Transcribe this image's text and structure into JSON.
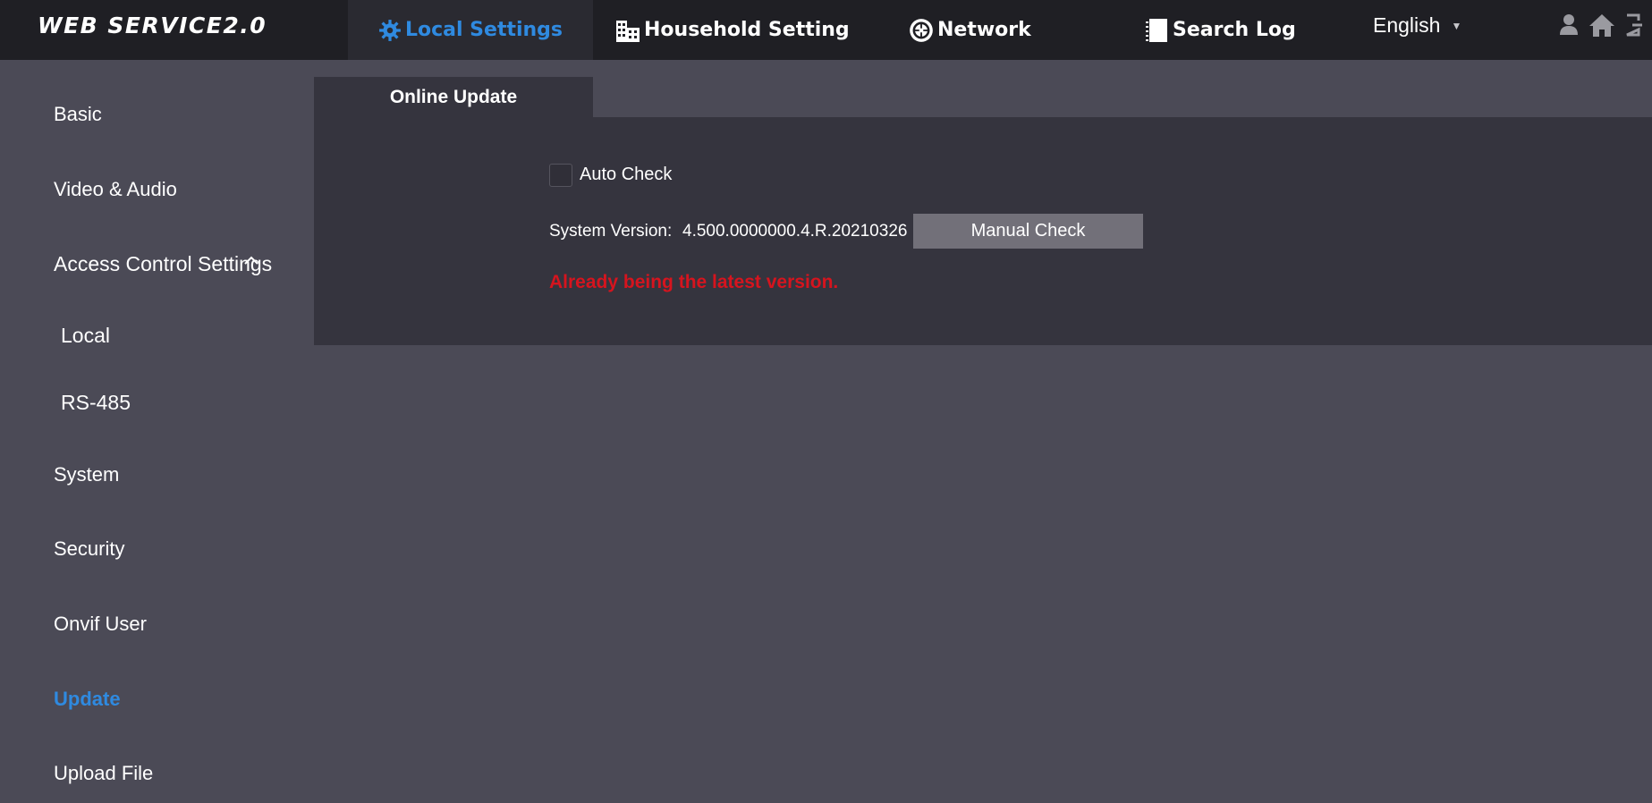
{
  "header": {
    "logo": "WEB SERVICE2.0",
    "nav": [
      {
        "label": "Local Settings",
        "icon": "gear-icon",
        "active": true
      },
      {
        "label": "Household Setting",
        "icon": "building-icon",
        "active": false
      },
      {
        "label": "Network",
        "icon": "globe-icon",
        "active": false
      },
      {
        "label": "Search Log",
        "icon": "log-icon",
        "active": false
      }
    ],
    "language": "English",
    "icons": [
      "user-icon",
      "home-icon",
      "logout-icon"
    ]
  },
  "sidebar": {
    "items": [
      {
        "label": "Basic"
      },
      {
        "label": "Video & Audio"
      },
      {
        "label": "Access Control Settings",
        "expanded": true
      },
      {
        "label": "Local"
      },
      {
        "label": "RS-485"
      },
      {
        "label": "System"
      },
      {
        "label": "Security"
      },
      {
        "label": "Onvif User"
      },
      {
        "label": "Update",
        "active": true
      },
      {
        "label": "Upload File"
      }
    ]
  },
  "main": {
    "tab": "Online Update",
    "auto_check_label": "Auto Check",
    "auto_check_checked": false,
    "system_version_label": "System Version:",
    "system_version": "4.500.0000000.4.R.20210326",
    "manual_check_label": "Manual Check",
    "status_message": "Already being the latest version."
  },
  "colors": {
    "accent": "#2f8ae0",
    "error": "#d6141e",
    "topbar": "#1f1f24",
    "background": "#4b4a56",
    "panel": "#35343e"
  }
}
